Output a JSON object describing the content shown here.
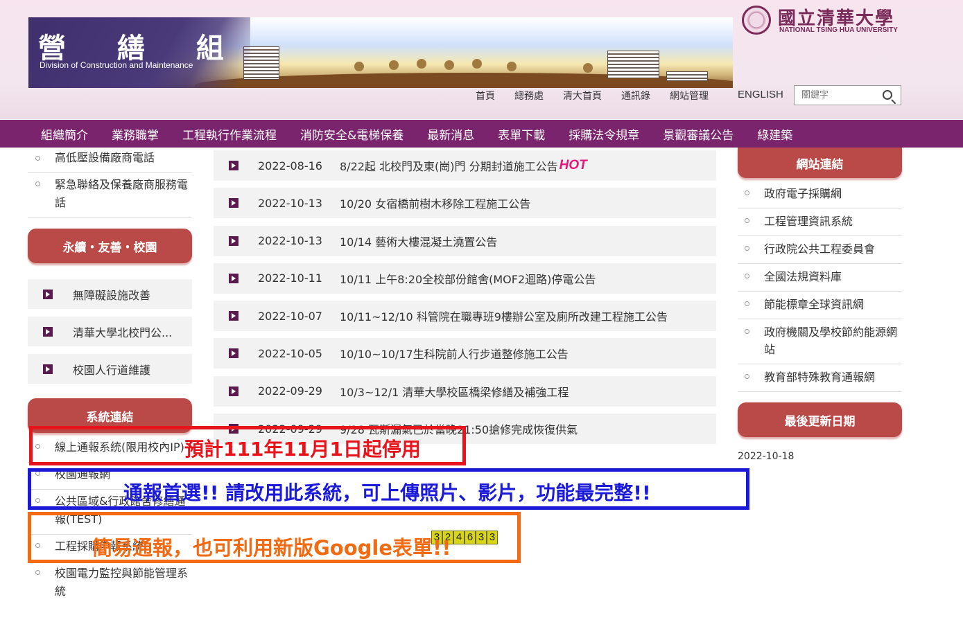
{
  "header": {
    "banner_title": "營 繕 組",
    "banner_subtitle": "Division of Construction and Maintenance",
    "logo_cn": "國立清華大學",
    "logo_en": "NATIONAL TSING HUA UNIVERSITY",
    "top_links": [
      "首頁",
      "總務處",
      "清大首頁",
      "通訊錄",
      "網站管理"
    ],
    "english": "ENGLISH",
    "search_placeholder": "關鍵字"
  },
  "nav": [
    "組織簡介",
    "業務職掌",
    "工程執行作業流程",
    "消防安全&電梯保養",
    "最新消息",
    "表單下載",
    "採購法令規章",
    "景觀審議公告",
    "綠建築"
  ],
  "left": {
    "top_items": [
      "高低壓設備廠商電話",
      "緊急聯絡及保養廠商服務電話"
    ],
    "section1_title": "永續・友善・校園",
    "section1_items": [
      "無障礙設施改善",
      "清華大學北校門公...",
      "校園人行道維護"
    ],
    "section2_title": "系統連結",
    "section2_items": [
      "線上通報系統(限用校內IP)",
      "校園通報網",
      "公共區域&行政館舍修繕通報(TEST)",
      "工程採購申報系統",
      "校園電力監控與節能管理系統"
    ]
  },
  "news": [
    {
      "date": "2022-08-16",
      "title": "8/22起 北校門及東(崗)門 分期封道施工公告",
      "hot": "HOT"
    },
    {
      "date": "2022-10-13",
      "title": "10/20 女宿橋前樹木移除工程施工公告"
    },
    {
      "date": "2022-10-13",
      "title": "10/14 藝術大樓混凝土澆置公告"
    },
    {
      "date": "2022-10-11",
      "title": "10/11 上午8:20全校部份館舍(MOF2迴路)停電公告"
    },
    {
      "date": "2022-10-07",
      "title": "10/11~12/10 科管院在職專班9樓辦公室及廁所改建工程施工公告"
    },
    {
      "date": "2022-10-05",
      "title": "10/10~10/17生科院前人行步道整修施工公告"
    },
    {
      "date": "2022-09-29",
      "title": "10/3~12/1 清華大學校區橋梁修繕及補強工程"
    },
    {
      "date": "2022-09-29",
      "title": "9/28 瓦斯漏氣已於當晚21:50搶修完成恢復供氣"
    }
  ],
  "right": {
    "links_title": "網站連結",
    "links": [
      "政府電子採購網",
      "工程管理資訊系統",
      "行政院公共工程委員會",
      "全國法規資料庫",
      "節能標章全球資訊網",
      "政府機關及學校節約能源網站",
      "教育部特殊教育通報網"
    ],
    "update_title": "最後更新日期",
    "update_date": "2022-10-18"
  },
  "counter": [
    "3",
    "2",
    "4",
    "6",
    "3",
    "3"
  ],
  "annotations": {
    "red_text": "預計111年11月1日起停用",
    "blue_text": "通報首選!! 請改用此系統，可上傳照片、影片，功能最完整!!",
    "orange_text": "簡易通報，也可利用新版Google表單!!",
    "colors": {
      "red": "#e8141c",
      "blue": "#1a1ad8",
      "orange": "#f26b12"
    }
  }
}
